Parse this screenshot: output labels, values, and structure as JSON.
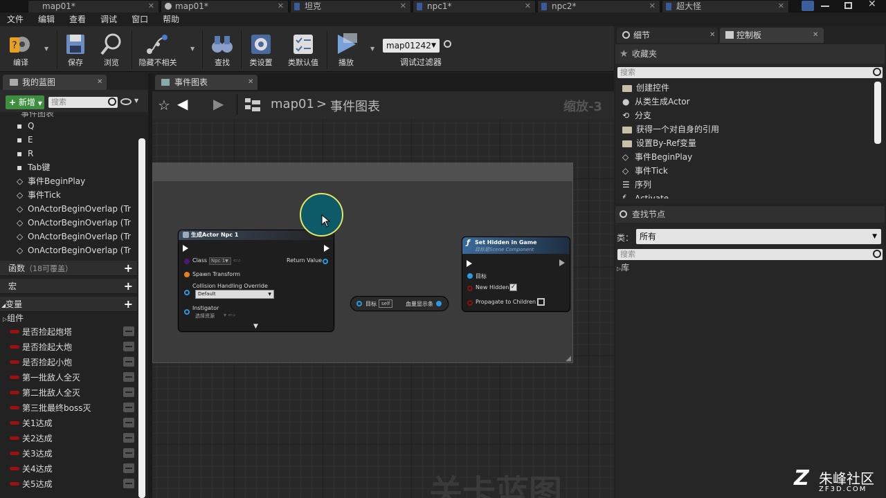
{
  "doc_tabs": [
    {
      "label": "map01*"
    },
    {
      "label": "map01*"
    },
    {
      "label": "坦克"
    },
    {
      "label": "npc1*"
    },
    {
      "label": "npc2*"
    },
    {
      "label": "超大怪"
    }
  ],
  "menu": [
    "文件",
    "编辑",
    "查看",
    "调试",
    "窗口",
    "帮助"
  ],
  "toolbar": {
    "compile": "编译",
    "save": "保存",
    "browse": "浏览",
    "hide_unrelated": "隐藏不相关",
    "find": "查找",
    "class_settings": "类设置",
    "class_defaults": "类默认值",
    "play": "播放",
    "debug_object": "map01242",
    "debug_filter": "调试过滤器"
  },
  "left_panel": {
    "tab": "我的蓝图",
    "new_button": "新增",
    "search_placeholder": "搜索",
    "event_graph_label": "事件图表",
    "events": [
      "Q",
      "E",
      "R",
      "Tab键",
      "事件BeginPlay",
      "事件Tick",
      "OnActorBeginOverlap (Tr",
      "OnActorBeginOverlap (Tr",
      "OnActorBeginOverlap (Tr",
      "OnActorBeginOverlap (Tr"
    ],
    "functions_label": "函数",
    "functions_note": "（18可覆盖）",
    "macros_label": "宏",
    "variables_label": "变量",
    "components_label": "组件",
    "variables": [
      "是否捡起炮塔",
      "是否捡起大炮",
      "是否捡起小炮",
      "第一批敌人全灭",
      "第二批敌人全灭",
      "第三批最终boss灭",
      "关1达成",
      "关2达成",
      "关3达成",
      "关4达成",
      "关5达成"
    ]
  },
  "graph": {
    "tab": "事件图表",
    "breadcrumb_root": "map01",
    "breadcrumb_sep": ">",
    "breadcrumb_leaf": "事件图表",
    "zoom": "缩放-3",
    "watermark": "关卡蓝图",
    "spawn_node": {
      "title": "生成Actor Npc 1",
      "class_label": "Class",
      "class_value": "Npc 1",
      "return_value": "Return Value",
      "spawn_transform": "Spawn Transform",
      "collision_label": "Collision Handling Override",
      "collision_value": "Default",
      "instigator_label": "Instigator",
      "instigator_value": "选择资源"
    },
    "get_node": {
      "target": "目标",
      "self_value": "self",
      "output": "血量显示条"
    },
    "hidden_node": {
      "title": "Set Hidden in Game",
      "subtitle": "目标是Scene Component",
      "target": "目标",
      "new_hidden": "New Hidden",
      "propagate": "Propagate to Children"
    }
  },
  "right_panel": {
    "tab_details": "细节",
    "tab_palette": "控制板",
    "favorites_label": "收藏夹",
    "search_placeholder": "搜索",
    "favorites": [
      "创建控件",
      "从类生成Actor",
      "分支",
      "获得一个对自身的引用",
      "设置By-Ref变量",
      "事件BeginPlay",
      "事件Tick",
      "序列",
      "Activate"
    ],
    "find_nodes_label": "查找节点",
    "category_label": "类：",
    "category_value": "所有",
    "library_label": "库"
  },
  "watermark_logo": {
    "name": "朱峰社区",
    "url": "ZF3D.COM"
  }
}
